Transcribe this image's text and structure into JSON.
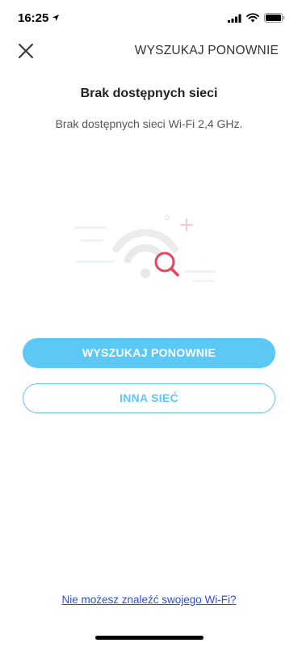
{
  "status_bar": {
    "time": "16:25",
    "icons": [
      "location-arrow-icon",
      "signal-icon",
      "wifi-icon",
      "battery-icon"
    ]
  },
  "header": {
    "close_icon": "close-icon",
    "rescan_label": "WYSZUKAJ PONOWNIE"
  },
  "main": {
    "title": "Brak dostępnych sieci",
    "subtitle": "Brak dostępnych sieci Wi-Fi 2,4 GHz.",
    "illustration_icon": "wifi-search-icon"
  },
  "actions": {
    "primary_label": "WYSZUKAJ PONOWNIE",
    "secondary_label": "INNA SIEĆ"
  },
  "footer": {
    "help_link": "Nie możesz znaleźć swojego Wi-Fi?"
  },
  "colors": {
    "accent": "#5cc8f6",
    "link": "#2a4fd6",
    "search_icon": "#e8475b"
  }
}
